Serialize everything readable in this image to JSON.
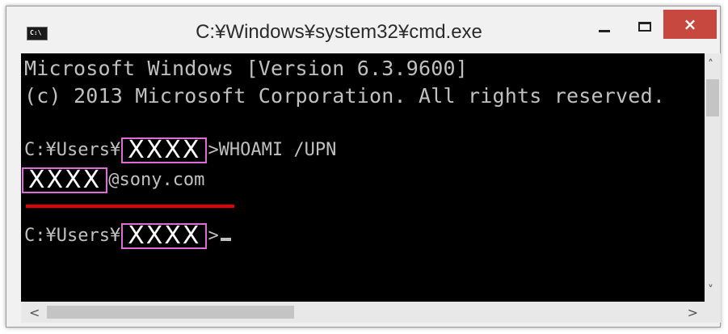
{
  "window": {
    "title": "C:¥Windows¥system32¥cmd.exe",
    "icon": "console-icon",
    "icon_glyph": "C:\\",
    "controls": {
      "minimize": "minimize-icon",
      "maximize": "maximize-icon",
      "close": "×"
    }
  },
  "console": {
    "line1": "Microsoft Windows [Version 6.3.9600]",
    "line2": "(c) 2013 Microsoft Corporation. All rights reserved.",
    "prompt1_prefix": "C:¥Users¥",
    "prompt1_redacted": "XXXX",
    "prompt1_suffix": ">WHOAMI /UPN",
    "upn_redacted": "XXXX",
    "upn_suffix": "@sony.com",
    "prompt2_prefix": "C:¥Users¥",
    "prompt2_redacted": "XXXX",
    "prompt2_suffix": ">"
  },
  "scrollbars": {
    "up": "˄",
    "down": "˅",
    "left": "<",
    "right": ">"
  },
  "colors": {
    "console_bg": "#000000",
    "console_text": "#c0c0c0",
    "redaction_border": "#e06ad6",
    "highlight_underline": "#e00000",
    "close_button": "#c7483e"
  }
}
